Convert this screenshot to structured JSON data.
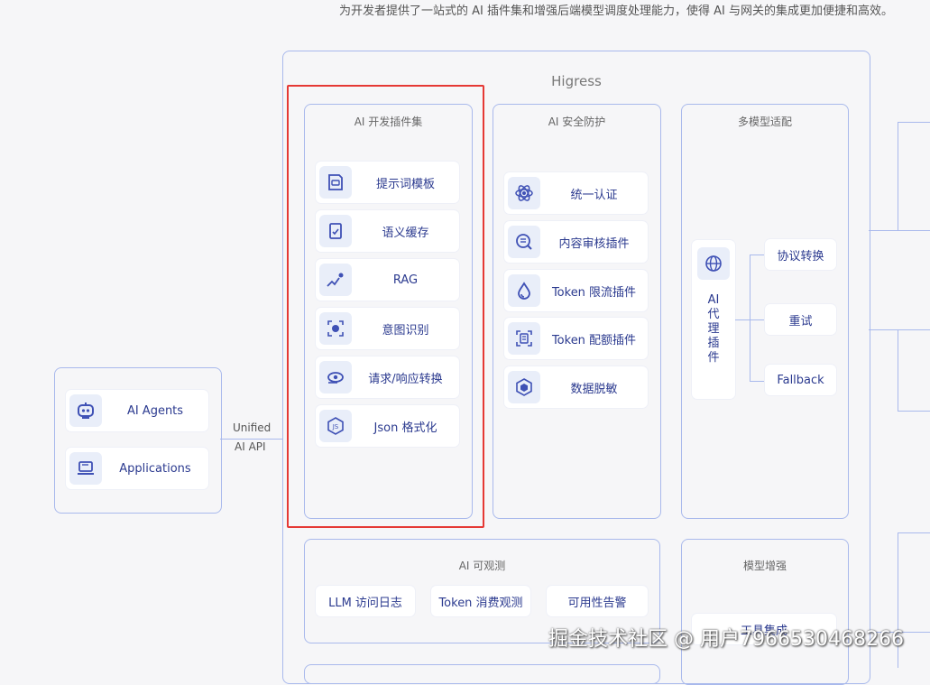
{
  "caption": "为开发者提供了一站式的 AI 插件集和增强后端模型调度处理能力，使得 AI 与网关的集成更加便捷和高效。",
  "clients": {
    "items": [
      {
        "label": "AI Agents",
        "icon": "robot-icon"
      },
      {
        "label": "Applications",
        "icon": "laptop-icon"
      }
    ],
    "connector_line1": "Unified",
    "connector_line2": "AI API"
  },
  "higress": {
    "title": "Higress",
    "dev_plugins": {
      "title": "AI 开发插件集",
      "items": [
        {
          "label": "提示词模板",
          "icon": "template-icon"
        },
        {
          "label": "语义缓存",
          "icon": "cache-icon"
        },
        {
          "label": "RAG",
          "icon": "rag-chart-icon"
        },
        {
          "label": "意图识别",
          "icon": "face-scan-icon"
        },
        {
          "label": "请求/响应转换",
          "icon": "transform-icon"
        },
        {
          "label": "Json 格式化",
          "icon": "js-icon"
        }
      ]
    },
    "security": {
      "title": "AI 安全防护",
      "items": [
        {
          "label": "统一认证",
          "icon": "atom-lock-icon"
        },
        {
          "label": "内容审核插件",
          "icon": "content-review-icon"
        },
        {
          "label": "Token 限流插件",
          "icon": "drop-icon"
        },
        {
          "label": "Token 配额插件",
          "icon": "quota-icon"
        },
        {
          "label": "数据脱敏",
          "icon": "cube-icon"
        }
      ]
    },
    "multi_model": {
      "title": "多模型适配",
      "proxy_label": "AI\n代\n理\n插\n件",
      "proxy_icon": "globe-icon",
      "branches": [
        "协议转换",
        "重试",
        "Fallback"
      ]
    },
    "observability": {
      "title": "AI 可观测",
      "items": [
        "LLM 访问日志",
        "Token 消费观测",
        "可用性告警"
      ]
    },
    "model_enhance": {
      "title": "模型增强",
      "items": [
        "工具集成"
      ]
    }
  },
  "watermark": "掘金技术社区 @ 用户7966530468266",
  "colors": {
    "accent": "#2b3a8f",
    "border": "#a9b9ec",
    "highlight": "#e53935",
    "icon_bg": "#e9eef9"
  }
}
